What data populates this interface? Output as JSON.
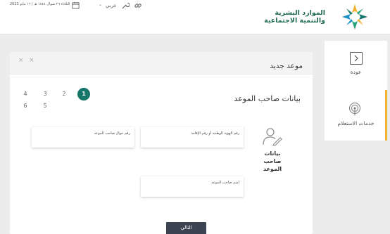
{
  "header": {
    "logo_line1": "الموارد البشرية",
    "logo_line2": "والتنمية الاجتماعية",
    "date": "الثلاثاء ٢٦ شوال ١٤٤٤ هـ | ١٦ مايو 2023",
    "language": "عربي"
  },
  "sidebar": {
    "back_label": "عودة",
    "inquiry_label": "خدمات الاستعلام"
  },
  "form": {
    "title": "موعد جديد",
    "close_symbol": "×",
    "section_title": "بيانات صاحب الموعد",
    "steps": [
      "1",
      "2",
      "3",
      "4",
      "5",
      "6"
    ],
    "user_label": "بيانات صاحب الموعد",
    "fields": {
      "id_label": "رقم الهوية الوطنية أو رقم الإقامة",
      "mobile_label": "رقم جوال صاحب الموعد",
      "name_label": "اسم صاحب الموعد"
    },
    "next_label": "التالي"
  },
  "colors": {
    "brand_green": "#16766a",
    "accent_yellow": "#f2b234",
    "button_dark": "#3b4450"
  }
}
